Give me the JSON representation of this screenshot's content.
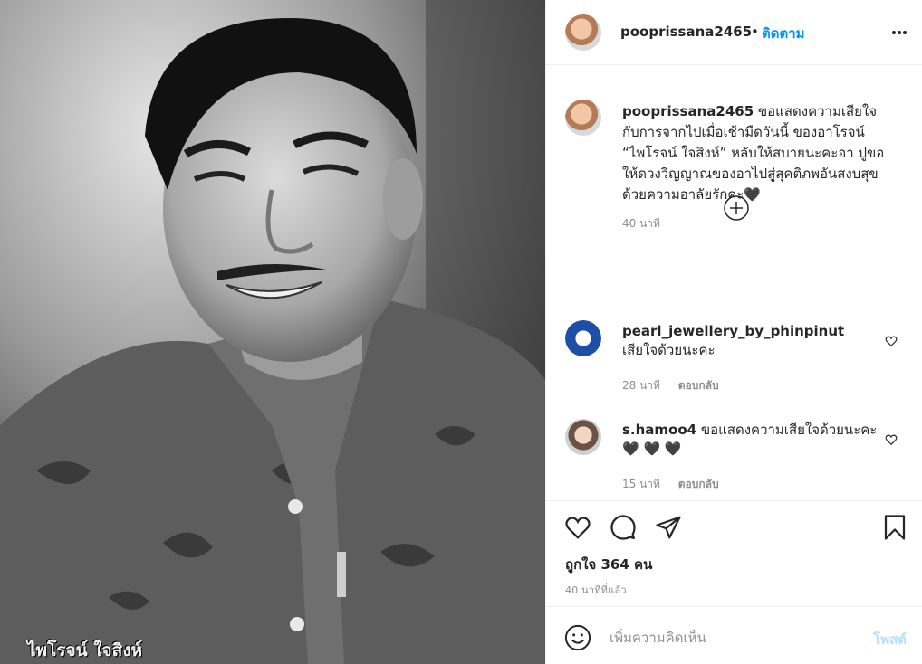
{
  "post": {
    "image_caption_overlay": "ไพโรจน์ ใจสิงห์"
  },
  "header": {
    "username": "pooprissana2465",
    "separator": "•",
    "follow_label": "ติดตาม",
    "more_icon": "more-horizontal-icon"
  },
  "caption": {
    "username": "pooprissana2465",
    "text": " ขอแสดงความเสียใจกับการจากไปเมื่อเช้ามืดวันนี้ ของอาโรจน์ “ไพโรจน์ ใจสิงห์” หลับให้สบายนะคะอา ปูขอให้ดวงวิญญาณของอาไปสู่สุคติภพอันสงบสุข ด้วยความอาลัยรักค่ะ🖤",
    "time": "40 นาที"
  },
  "load_more_icon": "plus-circle-icon",
  "comments": [
    {
      "username": "pearl_jewellery_by_phinpinut",
      "text": "เสียใจด้วยนะคะ",
      "time": "28 นาที",
      "reply_label": "ตอบกลับ"
    },
    {
      "username": "s.hamoo4",
      "text": " ขอแสดงความเสียใจด้วยนะคะ🖤 🖤 🖤",
      "time": "15 นาที",
      "reply_label": "ตอบกลับ"
    }
  ],
  "actions": {
    "likes": "ถูกใจ 364 คน",
    "post_time": "40 นาทีที่แล้ว"
  },
  "add_comment": {
    "placeholder": "เพิ่มความคิดเห็น",
    "post_label": "โพสต์"
  },
  "colors": {
    "link_blue": "#0095f6",
    "disabled_blue": "#b2dffc",
    "secondary_text": "#8e8e8e",
    "border": "#efefef"
  }
}
